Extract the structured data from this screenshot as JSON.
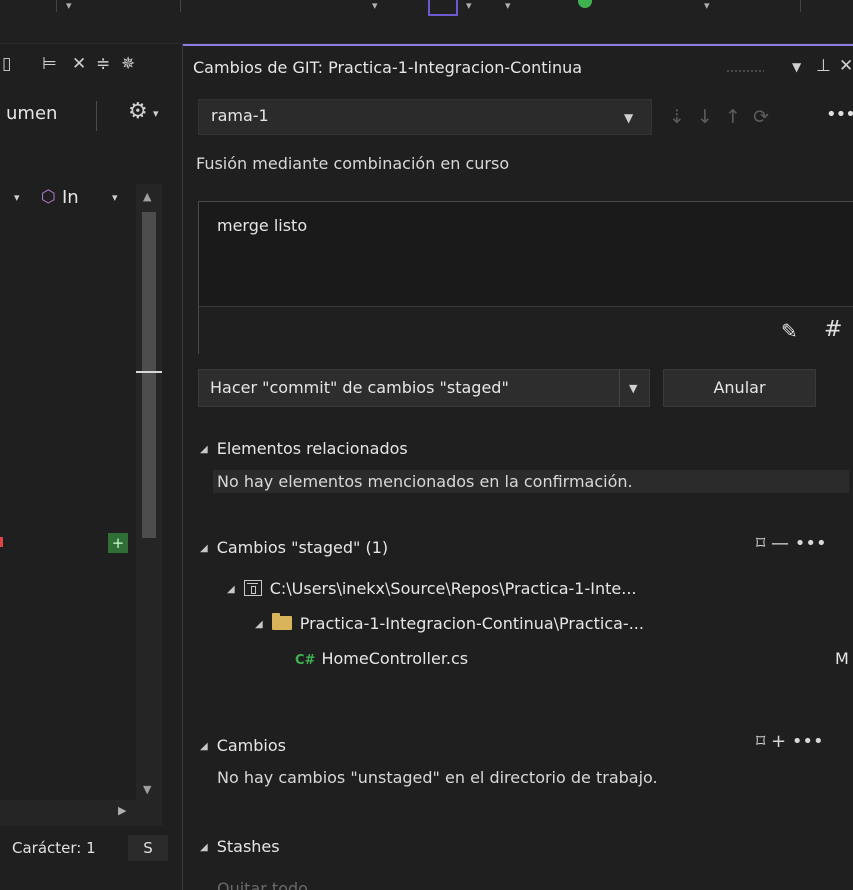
{
  "left_panel": {
    "toolbar_label": "umen",
    "filter_label": "In",
    "status_char": "Carácter: 1",
    "status_s": "S"
  },
  "git_panel": {
    "title": "Cambios de GIT: Practica-1-Integracion-Continua",
    "branch": "rama-1",
    "merge_status": "Fusión mediante combinación en curso",
    "commit_message": "merge listo",
    "commit_button": "Hacer \"commit\" de cambios \"staged\"",
    "cancel_button": "Anular",
    "related": {
      "header": "Elementos relacionados",
      "empty": "No hay elementos mencionados en la confirmación."
    },
    "staged": {
      "header": "Cambios \"staged\" (1)",
      "repo_path": "C:\\Users\\inekx\\Source\\Repos\\Practica-1-Inte...",
      "folder": "Practica-1-Integracion-Continua\\Practica-...",
      "file": "HomeController.cs",
      "file_status": "M"
    },
    "changes": {
      "header": "Cambios",
      "empty": "No hay cambios \"unstaged\" en el directorio de trabajo."
    },
    "stashes": {
      "header": "Stashes",
      "action": "Quitar todo"
    }
  },
  "colors": {
    "accent": "#8a7ee6",
    "background": "#1f1f1f",
    "input_bg": "#2b2b2b",
    "cs_icon": "#3fb24f",
    "folder_icon": "#d9b45a"
  }
}
